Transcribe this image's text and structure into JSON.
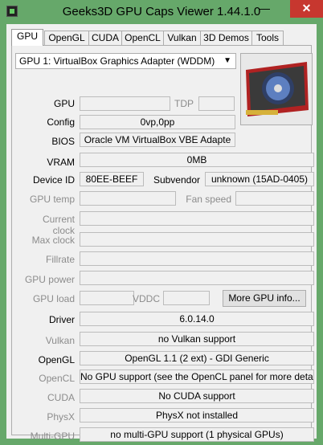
{
  "window": {
    "title": "Geeks3D GPU Caps Viewer 1.44.1.0",
    "minimize": "—",
    "maximize": "☐",
    "close": "✕"
  },
  "tabs": [
    "GPU",
    "OpenGL",
    "CUDA",
    "OpenCL",
    "Vulkan",
    "3D Demos",
    "Tools"
  ],
  "gpu_select": "GPU 1: VirtualBox Graphics Adapter (WDDM)",
  "rows": {
    "gpu": {
      "label": "GPU",
      "value": "",
      "tdp_label": "TDP",
      "tdp_value": ""
    },
    "config": {
      "label": "Config",
      "value": "0vp,0pp"
    },
    "bios": {
      "label": "BIOS",
      "value": "Oracle VM VirtualBox VBE Adapte"
    },
    "vram": {
      "label": "VRAM",
      "value": "0MB"
    },
    "device_id": {
      "label": "Device ID",
      "value": "80EE-BEEF",
      "subvendor_label": "Subvendor",
      "subvendor_value": "unknown (15AD-0405)"
    },
    "gpu_temp": {
      "label": "GPU temp",
      "value": "",
      "fan_label": "Fan speed",
      "fan_value": ""
    },
    "current_clock": {
      "label": "Current clock",
      "value": ""
    },
    "max_clock": {
      "label": "Max clock",
      "value": ""
    },
    "fillrate": {
      "label": "Fillrate",
      "value": ""
    },
    "gpu_power": {
      "label": "GPU power",
      "value": ""
    },
    "gpu_load": {
      "label": "GPU load",
      "value": "",
      "vddc_label": "VDDC",
      "vddc_value": "",
      "more_button": "More GPU info..."
    },
    "driver": {
      "label": "Driver",
      "value": "6.0.14.0"
    },
    "vulkan": {
      "label": "Vulkan",
      "value": "no Vulkan support"
    },
    "opengl": {
      "label": "OpenGL",
      "value": "OpenGL 1.1 (2 ext) - GDI Generic"
    },
    "opencl": {
      "label": "OpenCL",
      "value": "No GPU support (see the OpenCL panel for more details)"
    },
    "cuda": {
      "label": "CUDA",
      "value": "No CUDA support"
    },
    "physx": {
      "label": "PhysX",
      "value": "PhysX not installed"
    },
    "multigpu": {
      "label": "Multi-GPU",
      "value": "no multi-GPU support (1 physical GPUs)"
    }
  },
  "colors": {
    "titlebar": "#66a86a",
    "close": "#c7372f",
    "panel": "#f0f0f0"
  }
}
